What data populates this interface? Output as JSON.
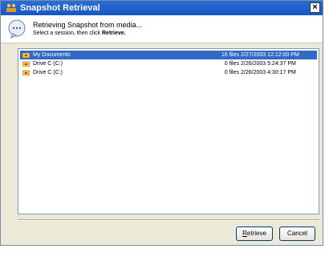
{
  "window": {
    "title": "Snapshot Retrieval",
    "close_symbol": "×",
    "app_icon": "people-icon"
  },
  "header": {
    "title": "Retrieving Snapshot from media...",
    "subtitle_prefix": "Select a session, then click",
    "subtitle_bold": "Retrieve.",
    "icon": "speech-bubble-icon"
  },
  "sessions": [
    {
      "name": "My Documents",
      "files": "16 files",
      "date": "2/27/2003 12:12:00 PM",
      "selected": true,
      "icon": "folder-icon"
    },
    {
      "name": "Drive C (C:)",
      "files": "0 files",
      "date": "2/26/2003 5:24:37 PM",
      "selected": false,
      "icon": "drive-icon"
    },
    {
      "name": "Drive C (C:)",
      "files": "0 files",
      "date": "2/26/2003 4:30:17 PM",
      "selected": false,
      "icon": "drive-icon"
    }
  ],
  "buttons": {
    "retrieve": "Retrieve",
    "cancel": "Cancel"
  },
  "colors": {
    "titlebar": "#1f62cf",
    "selection": "#316ac5",
    "dialog_bg": "#ece9d8"
  }
}
